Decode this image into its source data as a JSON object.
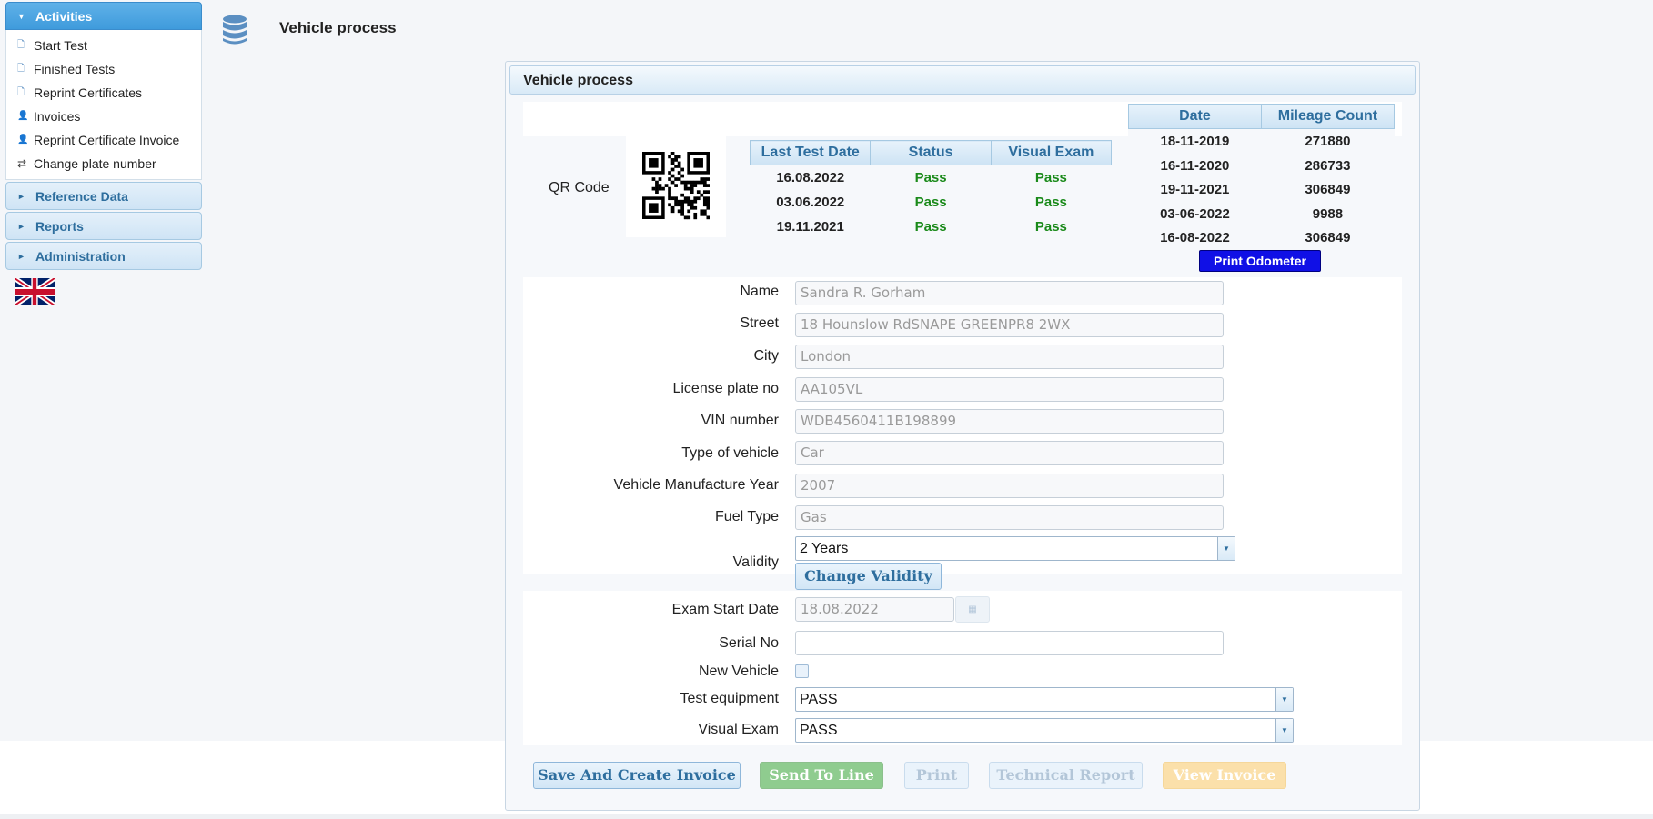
{
  "page": {
    "title": "Vehicle process"
  },
  "sidebar": {
    "activities": {
      "label": "Activities",
      "items": [
        {
          "label": "Start Test",
          "icon": "document-icon"
        },
        {
          "label": "Finished Tests",
          "icon": "document-icon"
        },
        {
          "label": "Reprint Certificates",
          "icon": "document-icon"
        },
        {
          "label": "Invoices",
          "icon": "user-icon"
        },
        {
          "label": "Reprint Certificate Invoice",
          "icon": "user-icon"
        },
        {
          "label": "Change plate number",
          "icon": "swap-icon"
        }
      ]
    },
    "sections": [
      "Reference Data",
      "Reports",
      "Administration"
    ],
    "language_flag": "uk-flag-icon"
  },
  "panel": {
    "title": "Vehicle process",
    "qr_label": "QR Code",
    "tests_table": {
      "headers": [
        "Last Test Date",
        "Status",
        "Visual Exam"
      ],
      "rows": [
        [
          "16.08.2022",
          "Pass",
          "Pass"
        ],
        [
          "03.06.2022",
          "Pass",
          "Pass"
        ],
        [
          "19.11.2021",
          "Pass",
          "Pass"
        ]
      ]
    },
    "mileage_table": {
      "headers": [
        "Date",
        "Mileage Count"
      ],
      "rows": [
        [
          "18-11-2019",
          "271880"
        ],
        [
          "16-11-2020",
          "286733"
        ],
        [
          "19-11-2021",
          "306849"
        ],
        [
          "03-06-2022",
          "9988"
        ],
        [
          "16-08-2022",
          "306849"
        ]
      ]
    },
    "print_odometer": "Print Odometer"
  },
  "form": {
    "name": {
      "label": "Name",
      "value": "Sandra R. Gorham"
    },
    "street": {
      "label": "Street",
      "value": "18 Hounslow RdSNAPE GREENPR8 2WX"
    },
    "city": {
      "label": "City",
      "value": "London"
    },
    "license_plate": {
      "label": "License plate no",
      "value": "AA105VL"
    },
    "vin": {
      "label": "VIN number",
      "value": "WDB4560411B198899"
    },
    "vehicle_type": {
      "label": "Type of vehicle",
      "value": "Car"
    },
    "manufacture_year": {
      "label": "Vehicle Manufacture Year",
      "value": "2007"
    },
    "fuel_type": {
      "label": "Fuel Type",
      "value": "Gas"
    },
    "validity": {
      "label": "Validity",
      "value": "2 Years"
    },
    "change_validity": "Change Validity",
    "exam_start_date": {
      "label": "Exam Start Date",
      "value": "18.08.2022"
    },
    "serial_no": {
      "label": "Serial No",
      "value": ""
    },
    "new_vehicle": {
      "label": "New Vehicle",
      "checked": false
    },
    "test_equipment": {
      "label": "Test equipment",
      "value": "PASS"
    },
    "visual_exam": {
      "label": "Visual Exam",
      "value": "PASS"
    }
  },
  "actions": {
    "save_invoice": "Save And Create Invoice",
    "send_line": "Send To Line",
    "print": "Print",
    "technical_report": "Technical Report",
    "view_invoice": "View Invoice"
  },
  "colors": {
    "accent": "#3f9bdc",
    "header_text": "#2e6e9e",
    "pass": "#1a8a1a",
    "odometer_button": "#1010e6"
  }
}
